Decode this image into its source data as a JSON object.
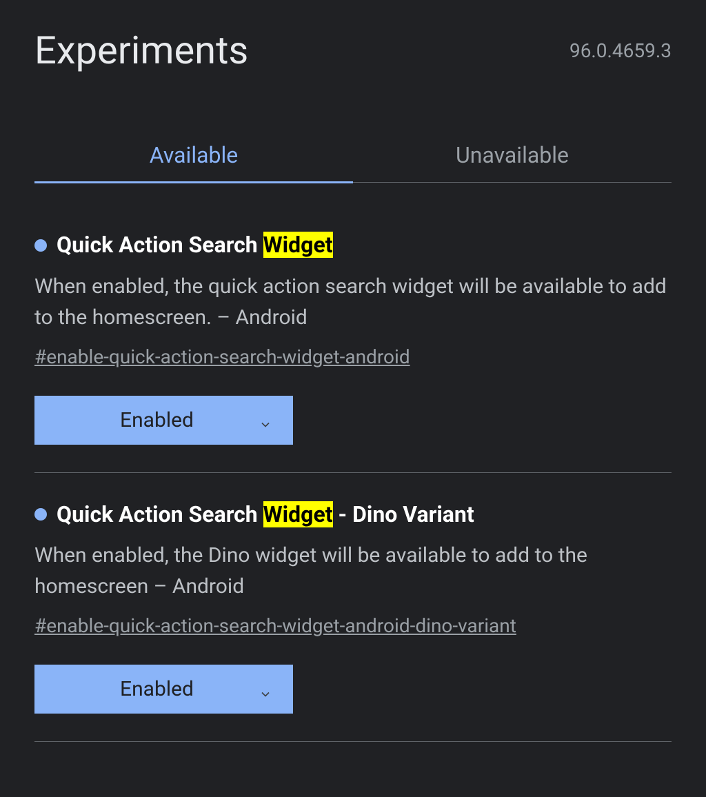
{
  "header": {
    "title": "Experiments",
    "version": "96.0.4659.3"
  },
  "tabs": {
    "available": "Available",
    "unavailable": "Unavailable"
  },
  "experiments": [
    {
      "titlePrefix": "Quick Action Search ",
      "titleHighlight": "Widget",
      "titleSuffix": "",
      "description": "When enabled, the quick action search widget will be available to add to the homescreen. – Android",
      "flag": "#enable-quick-action-search-widget-android",
      "dropdownValue": "Enabled"
    },
    {
      "titlePrefix": "Quick Action Search ",
      "titleHighlight": "Widget",
      "titleSuffix": " - Dino Variant",
      "description": "When enabled, the Dino widget will be available to add to the homescreen – Android",
      "flag": "#enable-quick-action-search-widget-android-dino-variant",
      "dropdownValue": "Enabled"
    }
  ]
}
